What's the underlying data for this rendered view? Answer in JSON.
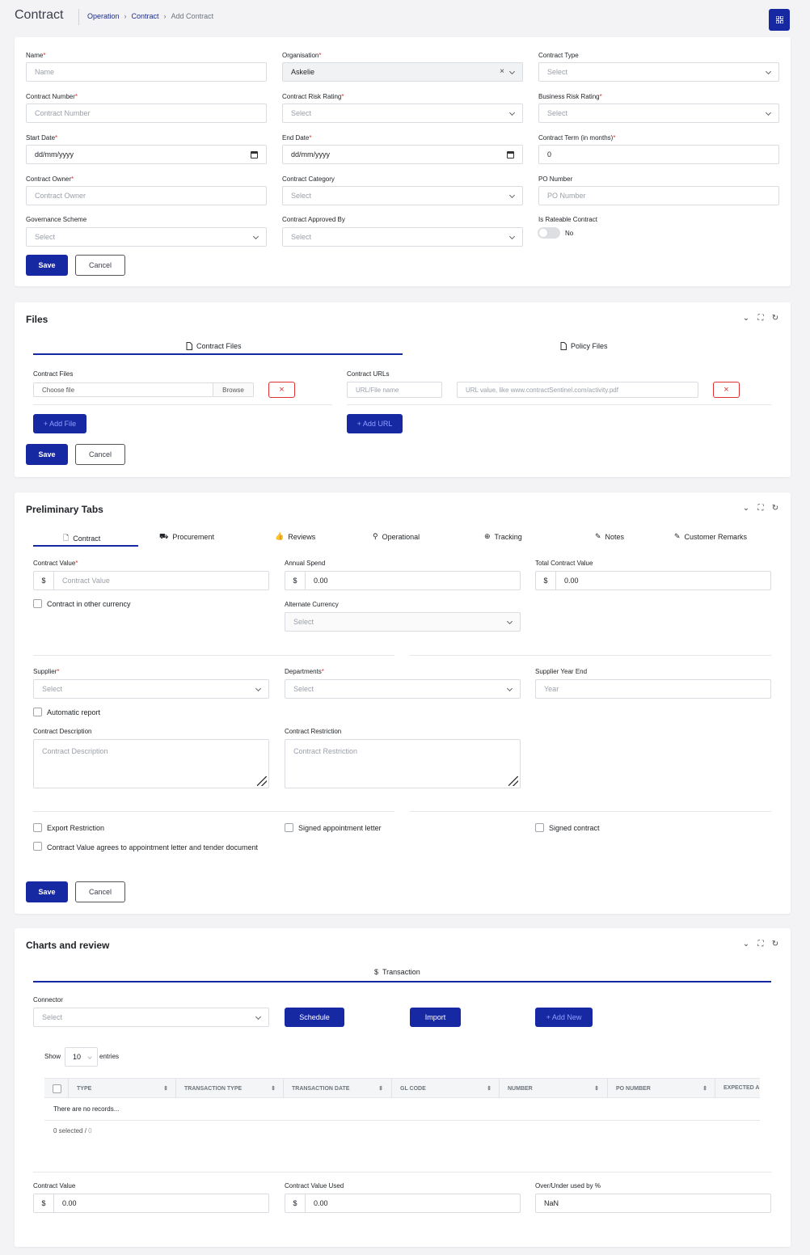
{
  "header": {
    "title": "Contract",
    "breadcrumb": [
      "Operation",
      "Contract",
      "Add Contract"
    ]
  },
  "contract_form": {
    "fields": {
      "name": {
        "label": "Name",
        "placeholder": "Name"
      },
      "organisation": {
        "label": "Organisation",
        "value": "Askelie"
      },
      "contract_type": {
        "label": "Contract Type",
        "placeholder": "Select"
      },
      "contract_number": {
        "label": "Contract Number",
        "placeholder": "Contract Number"
      },
      "contract_risk_rating": {
        "label": "Contract Risk Rating",
        "placeholder": "Select"
      },
      "business_risk_rating": {
        "label": "Business Risk Rating",
        "placeholder": "Select"
      },
      "start_date": {
        "label": "Start Date",
        "value": "dd/mm/yyyy"
      },
      "end_date": {
        "label": "End Date",
        "value": "dd/mm/yyyy"
      },
      "contract_term": {
        "label": "Contract Term (in months)",
        "value": "0"
      },
      "contract_owner": {
        "label": "Contract Owner",
        "placeholder": "Contract Owner"
      },
      "contract_category": {
        "label": "Contract Category",
        "placeholder": "Select"
      },
      "po_number": {
        "label": "PO Number",
        "placeholder": "PO Number"
      },
      "governance_scheme": {
        "label": "Governance Scheme",
        "placeholder": "Select"
      },
      "contract_approved_by": {
        "label": "Contract Approved By",
        "placeholder": "Select"
      },
      "is_rateable": {
        "label": "Is Rateable Contract",
        "value": "No"
      }
    },
    "save_label": "Save",
    "cancel_label": "Cancel"
  },
  "files": {
    "title": "Files",
    "tabs": [
      "Contract Files",
      "Policy Files"
    ],
    "contract_files_label": "Contract Files",
    "choose_file": "Choose file",
    "browse": "Browse",
    "contract_urls_label": "Contract URLs",
    "url_name_placeholder": "URL/File name",
    "url_value_placeholder": "URL value, like www.contractSentinel.com/activity.pdf",
    "add_file": "+ Add File",
    "add_url": "+ Add URL",
    "save_label": "Save",
    "cancel_label": "Cancel"
  },
  "preliminary": {
    "title": "Preliminary Tabs",
    "tabs": [
      "Contract",
      "Procurement",
      "Reviews",
      "Operational",
      "Tracking",
      "Notes",
      "Customer Remarks"
    ],
    "contract_value": {
      "label": "Contract Value",
      "prefix": "$",
      "placeholder": "Contract Value"
    },
    "annual_spend": {
      "label": "Annual Spend",
      "prefix": "$",
      "value": "0.00"
    },
    "total_contract_value": {
      "label": "Total Contract Value",
      "prefix": "$",
      "value": "0.00"
    },
    "other_currency": "Contract in other currency",
    "alternate_currency": {
      "label": "Alternate Currency",
      "placeholder": "Select"
    },
    "supplier": {
      "label": "Supplier",
      "placeholder": "Select"
    },
    "departments": {
      "label": "Departments",
      "placeholder": "Select"
    },
    "supplier_year_end": {
      "label": "Supplier Year End",
      "placeholder": "Year"
    },
    "automatic_report": "Automatic report",
    "contract_description": {
      "label": "Contract Description",
      "placeholder": "Contract Description"
    },
    "contract_restriction": {
      "label": "Contract Restriction",
      "placeholder": "Contract Restriction"
    },
    "export_restriction": "Export Restriction",
    "signed_appointment": "Signed appointment letter",
    "signed_contract": "Signed contract",
    "value_agrees": "Contract Value agrees to appointment letter and tender document",
    "save_label": "Save",
    "cancel_label": "Cancel"
  },
  "charts": {
    "title": "Charts and review",
    "tab": "Transaction",
    "tab_prefix": "$",
    "connector": {
      "label": "Connector",
      "placeholder": "Select"
    },
    "schedule": "Schedule",
    "import": "Import",
    "add_new": "+ Add New",
    "show": "Show",
    "entries_value": "10",
    "entries": "entries",
    "columns": [
      "TYPE",
      "TRANSACTION TYPE",
      "TRANSACTION DATE",
      "GL CODE",
      "NUMBER",
      "PO NUMBER",
      "EXPECTED A"
    ],
    "no_records": "There are no records...",
    "selected_text": "0 selected /",
    "selected_total": "0",
    "contract_value": {
      "label": "Contract Value",
      "prefix": "$",
      "value": "0.00"
    },
    "contract_value_used": {
      "label": "Contract Value Used",
      "prefix": "$",
      "value": "0.00"
    },
    "over_under": {
      "label": "Over/Under used by %",
      "value": "NaN"
    }
  },
  "colors": {
    "primary": "#1728a3",
    "danger": "#e03131",
    "page_bg": "#f3f3f6"
  }
}
